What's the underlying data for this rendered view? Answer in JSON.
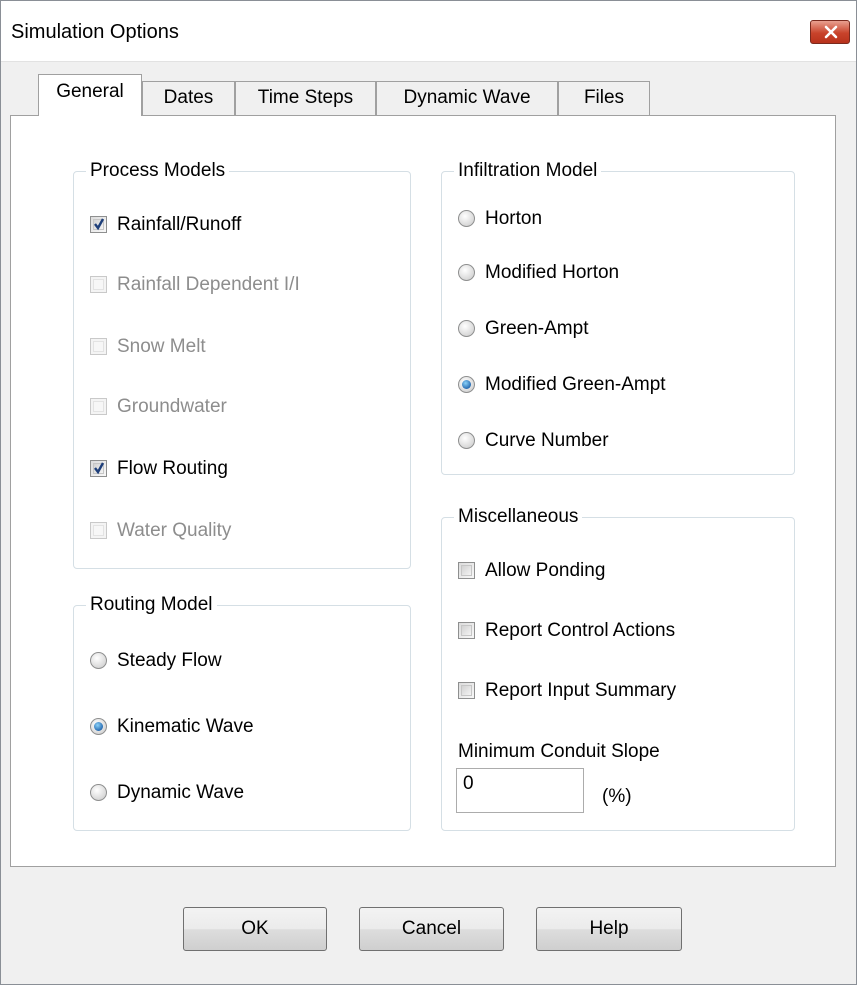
{
  "window": {
    "title": "Simulation Options"
  },
  "tabs": [
    "General",
    "Dates",
    "Time Steps",
    "Dynamic Wave",
    "Files"
  ],
  "process_models": {
    "title": "Process Models",
    "items": [
      {
        "label": "Rainfall/Runoff",
        "checked": true,
        "enabled": true
      },
      {
        "label": "Rainfall Dependent I/I",
        "checked": false,
        "enabled": false
      },
      {
        "label": "Snow Melt",
        "checked": false,
        "enabled": false
      },
      {
        "label": "Groundwater",
        "checked": false,
        "enabled": false
      },
      {
        "label": "Flow Routing",
        "checked": true,
        "enabled": true
      },
      {
        "label": "Water Quality",
        "checked": false,
        "enabled": false
      }
    ]
  },
  "routing_model": {
    "title": "Routing Model",
    "options": [
      "Steady Flow",
      "Kinematic Wave",
      "Dynamic Wave"
    ],
    "selected": "Kinematic Wave"
  },
  "infiltration_model": {
    "title": "Infiltration Model",
    "options": [
      "Horton",
      "Modified Horton",
      "Green-Ampt",
      "Modified Green-Ampt",
      "Curve Number"
    ],
    "selected": "Modified Green-Ampt"
  },
  "miscellaneous": {
    "title": "Miscellaneous",
    "items": [
      {
        "label": "Allow Ponding",
        "checked": false
      },
      {
        "label": "Report Control Actions",
        "checked": false
      },
      {
        "label": "Report Input Summary",
        "checked": false
      }
    ],
    "min_slope_label": "Minimum Conduit Slope",
    "min_slope_value": "0",
    "min_slope_unit": "(%)"
  },
  "buttons": {
    "ok": "OK",
    "cancel": "Cancel",
    "help": "Help"
  }
}
